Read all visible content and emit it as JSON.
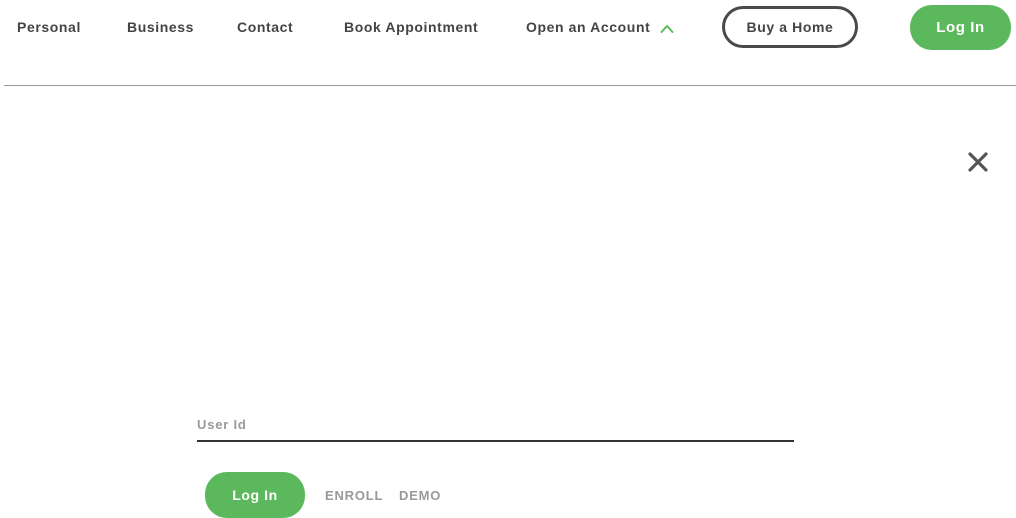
{
  "nav": {
    "links": [
      {
        "label": "Personal"
      },
      {
        "label": "Business"
      },
      {
        "label": "Contact"
      },
      {
        "label": "Book Appointment"
      }
    ],
    "open_account": {
      "label": "Open an Account",
      "icon": "chevron-up-icon"
    },
    "buy_home_label": "Buy a Home",
    "login_label": "Log In"
  },
  "modal": {
    "close_icon": "close-icon",
    "user_id": {
      "placeholder": "User Id",
      "value": ""
    },
    "login_label": "Log In",
    "enroll_label": "ENROLL",
    "demo_label": "DEMO"
  },
  "colors": {
    "accent_green": "#5cb85c",
    "text_dark": "#444444",
    "text_muted": "#999999",
    "divider": "#9a9a9a"
  }
}
